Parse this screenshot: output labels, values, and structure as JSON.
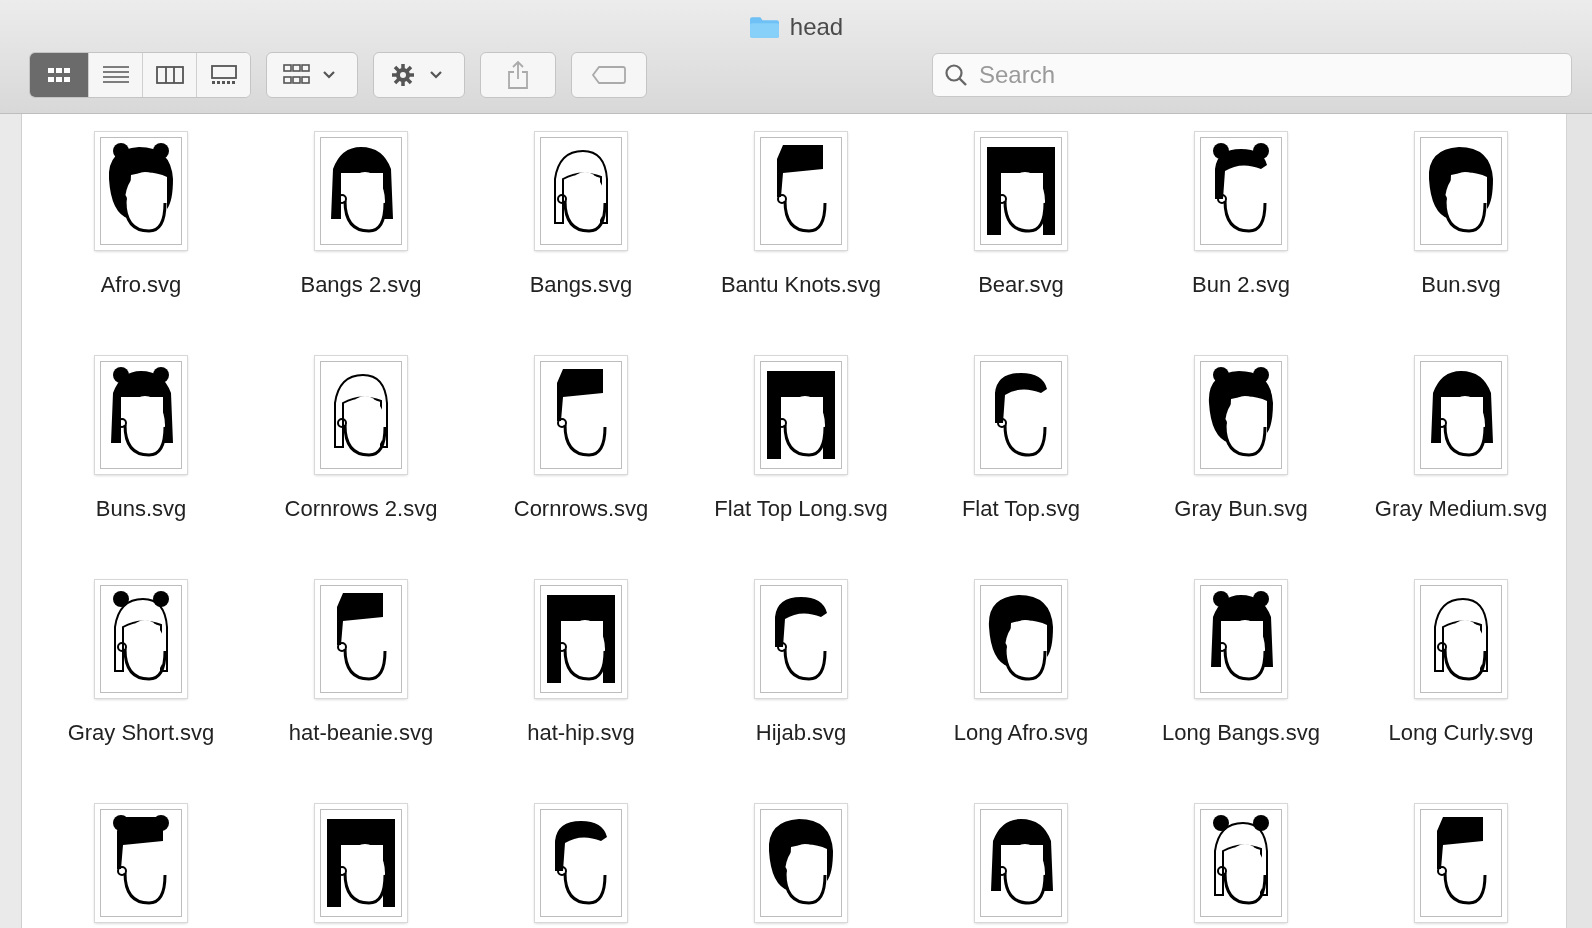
{
  "window": {
    "title": "head"
  },
  "view_modes": [
    {
      "kind": "icons",
      "selected": true
    },
    {
      "kind": "list",
      "selected": false
    },
    {
      "kind": "columns",
      "selected": false
    },
    {
      "kind": "gallery",
      "selected": false
    }
  ],
  "search": {
    "placeholder": "Search"
  },
  "files": [
    {
      "kind": "thumbnail",
      "name": "Afro.svg"
    },
    {
      "kind": "thumbnail",
      "name": "Bangs 2.svg"
    },
    {
      "kind": "thumbnail",
      "name": "Bangs.svg"
    },
    {
      "kind": "thumbnail",
      "name": "Bantu Knots.svg"
    },
    {
      "kind": "thumbnail",
      "name": "Bear.svg"
    },
    {
      "kind": "thumbnail",
      "name": "Bun 2.svg"
    },
    {
      "kind": "thumbnail",
      "name": "Bun.svg"
    },
    {
      "kind": "thumbnail",
      "name": "Buns.svg"
    },
    {
      "kind": "thumbnail",
      "name": "Cornrows 2.svg"
    },
    {
      "kind": "thumbnail",
      "name": "Cornrows.svg"
    },
    {
      "kind": "thumbnail",
      "name": "Flat Top Long.svg"
    },
    {
      "kind": "thumbnail",
      "name": "Flat Top.svg"
    },
    {
      "kind": "thumbnail",
      "name": "Gray Bun.svg"
    },
    {
      "kind": "thumbnail",
      "name": "Gray Medium.svg"
    },
    {
      "kind": "thumbnail",
      "name": "Gray Short.svg"
    },
    {
      "kind": "thumbnail",
      "name": "hat-beanie.svg"
    },
    {
      "kind": "thumbnail",
      "name": "hat-hip.svg"
    },
    {
      "kind": "thumbnail",
      "name": "Hijab.svg"
    },
    {
      "kind": "thumbnail",
      "name": "Long Afro.svg"
    },
    {
      "kind": "thumbnail",
      "name": "Long Bangs.svg"
    },
    {
      "kind": "thumbnail",
      "name": "Long Curly.svg"
    },
    {
      "kind": "thumbnail"
    },
    {
      "kind": "thumbnail"
    },
    {
      "kind": "thumbnail"
    },
    {
      "kind": "thumbnail"
    },
    {
      "kind": "thumbnail"
    },
    {
      "kind": "thumbnail"
    },
    {
      "kind": "thumbnail"
    }
  ]
}
